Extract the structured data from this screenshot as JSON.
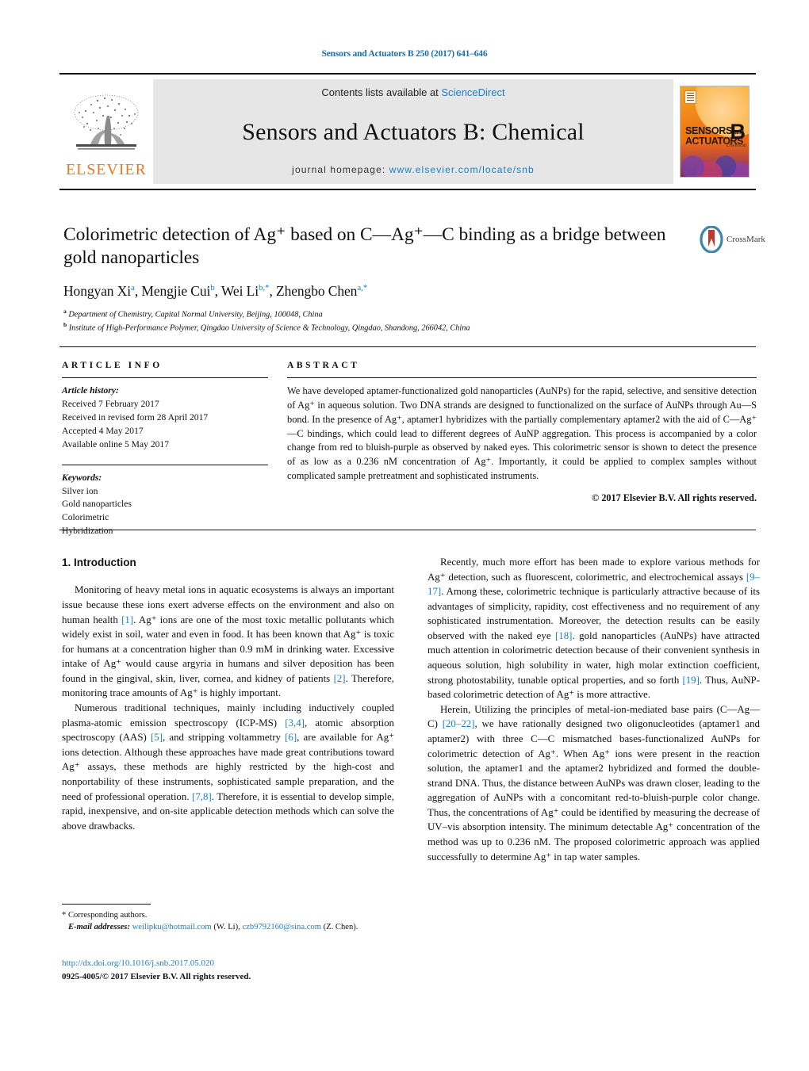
{
  "running_head": "Sensors and Actuators B 250 (2017) 641–646",
  "masthead": {
    "contents_prefix": "Contents lists available at ",
    "contents_link": "ScienceDirect",
    "journal_title": "Sensors and Actuators B: Chemical",
    "homepage_label": "journal homepage: ",
    "homepage_url": "www.elsevier.com/locate/snb",
    "publisher": "ELSEVIER",
    "cover": {
      "line1": "SENSORS",
      "line1_small": "and",
      "line2": "ACTUATORS",
      "volume_letter": "B",
      "volume_sub": "Chemical"
    }
  },
  "article": {
    "title": "Colorimetric detection of Ag⁺ based on C—Ag⁺—C binding as a bridge between gold nanoparticles",
    "authors_html": "Hongyan Xi<sup>a</sup>, Mengjie Cui<sup>b</sup>, Wei Li<sup>b,*</sup>, Zhengbo Chen<sup>a,*</sup>",
    "affiliations": [
      {
        "marker": "a",
        "text": "Department of Chemistry, Capital Normal University, Beijing, 100048, China"
      },
      {
        "marker": "b",
        "text": "Institute of High-Performance Polymer, Qingdao University of Science & Technology, Qingdao, Shandong, 266042, China"
      }
    ],
    "crossmark_label": "CrossMark"
  },
  "article_info": {
    "heading": "ARTICLE INFO",
    "history_label": "Article history:",
    "history": [
      "Received 7 February 2017",
      "Received in revised form 28 April 2017",
      "Accepted 4 May 2017",
      "Available online 5 May 2017"
    ],
    "keywords_label": "Keywords:",
    "keywords": [
      "Silver ion",
      "Gold nanoparticles",
      "Colorimetric",
      "Hybridization"
    ]
  },
  "abstract": {
    "heading": "ABSTRACT",
    "text": "We have developed aptamer-functionalized gold nanoparticles (AuNPs) for the rapid, selective, and sensitive detection of Ag⁺ in aqueous solution. Two DNA strands are designed to functionalized on the surface of AuNPs through Au—S bond. In the presence of Ag⁺, aptamer1 hybridizes with the partially complementary aptamer2 with the aid of C—Ag⁺—C bindings, which could lead to different degrees of AuNP aggregation. This process is accompanied by a color change from red to bluish-purple as observed by naked eyes. This colorimetric sensor is shown to detect the presence of as low as a 0.236 nM concentration of Ag⁺. Importantly, it could be applied to complex samples without complicated sample pretreatment and sophisticated instruments.",
    "copyright": "© 2017 Elsevier B.V. All rights reserved."
  },
  "body": {
    "section_heading": "1. Introduction",
    "left_paragraphs": [
      "Monitoring of heavy metal ions in aquatic ecosystems is always an important issue because these ions exert adverse effects on the environment and also on human health [1]. Ag⁺ ions are one of the most toxic metallic pollutants which widely exist in soil, water and even in food. It has been known that Ag⁺ is toxic for humans at a concentration higher than 0.9 mM in drinking water. Excessive intake of Ag⁺ would cause argyria in humans and silver deposition has been found in the gingival, skin, liver, cornea, and kidney of patients [2]. Therefore, monitoring trace amounts of Ag⁺ is highly important.",
      "Numerous traditional techniques, mainly including inductively coupled plasma-atomic emission spectroscopy (ICP-MS) [3,4], atomic absorption spectroscopy (AAS) [5], and stripping voltammetry [6], are available for Ag⁺ ions detection. Although these approaches have made great contributions toward Ag⁺ assays, these methods are highly restricted by the high-cost and nonportability of these instruments, sophisticated sample preparation, and the need of professional operation. [7,8]. Therefore, it is essential to develop simple, rapid, inexpensive, and on-site applicable detection methods which can solve the above drawbacks."
    ],
    "right_paragraphs": [
      "Recently, much more effort has been made to explore various methods for Ag⁺ detection, such as fluorescent, colorimetric, and electrochemical assays [9–17]. Among these, colorimetric technique is particularly attractive because of its advantages of simplicity, rapidity, cost effectiveness and no requirement of any sophisticated instrumentation. Moreover, the detection results can be easily observed with the naked eye [18]. gold nanoparticles (AuNPs) have attracted much attention in colorimetric detection because of their convenient synthesis in aqueous solution, high solubility in water, high molar extinction coefficient, strong photostability, tunable optical properties, and so forth [19]. Thus, AuNP-based colorimetric detection of Ag⁺ is more attractive.",
      "Herein, Utilizing the principles of metal-ion-mediated base pairs (C—Ag—C) [20–22], we have rationally designed two oligonucleotides (aptamer1 and aptamer2) with three C—C mismatched bases-functionalized AuNPs for colorimetric detection of Ag⁺. When Ag⁺ ions were present in the reaction solution, the aptamer1 and the aptamer2 hybridized and formed the double-strand DNA. Thus, the distance between AuNPs was drawn closer, leading to the aggregation of AuNPs with a concomitant red-to-bluish-purple color change. Thus, the concentrations of Ag⁺ could be identified by measuring the decrease of UV–vis absorption intensity. The minimum detectable Ag⁺ concentration of the method was up to 0.236 nM. The proposed colorimetric approach was applied successfully to determine Ag⁺ in tap water samples."
    ]
  },
  "footnote": {
    "corresponding": "* Corresponding authors.",
    "email_label": "E-mail addresses:",
    "email1": "weilipku@hotmail.com",
    "email1_who": "(W. Li),",
    "email2": "czb9792160@sina.com",
    "email2_who": "(Z. Chen)."
  },
  "bottom": {
    "doi": "http://dx.doi.org/10.1016/j.snb.2017.05.020",
    "issn": "0925-4005/© 2017 Elsevier B.V. All rights reserved."
  },
  "colors": {
    "link": "#1a7ec8",
    "elsevier_orange": "#E87722",
    "running_head": "#1a6ea8"
  }
}
